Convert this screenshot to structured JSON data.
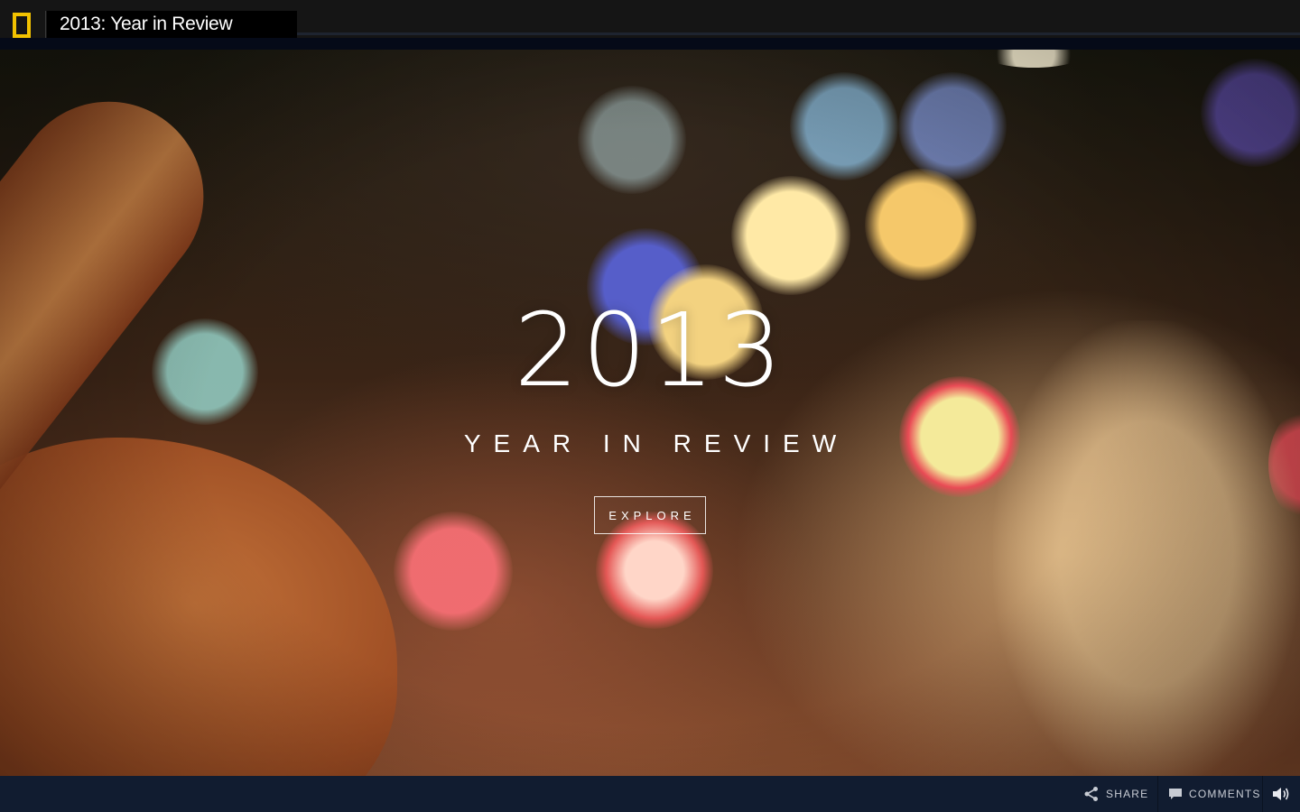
{
  "header": {
    "logo": "national-geographic-yellow-border-logo",
    "title": "2013: Year in Review",
    "logo_color": "#f2c200"
  },
  "hero": {
    "year": "2013",
    "subtitle": "YEAR IN REVIEW",
    "explore_label": "EXPLORE"
  },
  "footer": {
    "share_label": "SHARE",
    "comments_label": "COMMENTS",
    "share_icon": "share-icon",
    "comments_icon": "comment-icon",
    "sound_icon": "volume-icon",
    "background": "#111c30"
  }
}
